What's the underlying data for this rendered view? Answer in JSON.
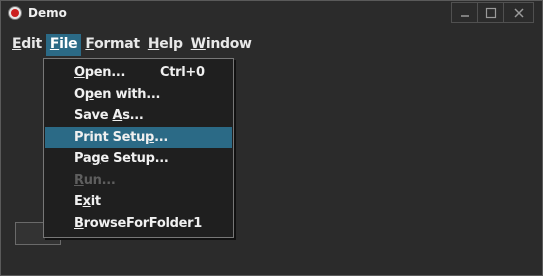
{
  "window": {
    "title": "Demo"
  },
  "titlebar_buttons": [
    "minimize-icon",
    "maximize-icon",
    "close-icon"
  ],
  "menubar": {
    "menus": [
      {
        "label": "Edit",
        "mnemonic": "E",
        "rest": "dit"
      },
      {
        "label": "File",
        "mnemonic": "F",
        "rest": "ile",
        "active": true
      },
      {
        "label": "Format",
        "mnemonic": "F",
        "rest": "ormat"
      },
      {
        "label": "Help",
        "mnemonic": "H",
        "rest": "elp"
      },
      {
        "label": "Window",
        "mnemonic": "W",
        "rest": "indow"
      }
    ]
  },
  "file_menu": {
    "items": [
      {
        "pre": "",
        "mn": "O",
        "post": "pen...",
        "accel": "Ctrl+0"
      },
      {
        "pre": "O",
        "mn": "p",
        "post": "en with..."
      },
      {
        "pre": "Save ",
        "mn": "A",
        "post": "s..."
      },
      {
        "pre": "Print Setu",
        "mn": "p",
        "post": "...",
        "highlighted": true
      },
      {
        "pre": "Pa",
        "mn": "g",
        "post": "e Setup..."
      },
      {
        "pre": "",
        "mn": "R",
        "post": "un...",
        "disabled": true
      },
      {
        "pre": "E",
        "mn": "x",
        "post": "it"
      },
      {
        "pre": "",
        "mn": "B",
        "post": "rowseForFolder1"
      }
    ]
  },
  "colors": {
    "accent": "#2b6a86",
    "background": "#2b2b2b",
    "menu_bg": "#1f1f1f",
    "disabled_text": "#5e5e5e"
  }
}
